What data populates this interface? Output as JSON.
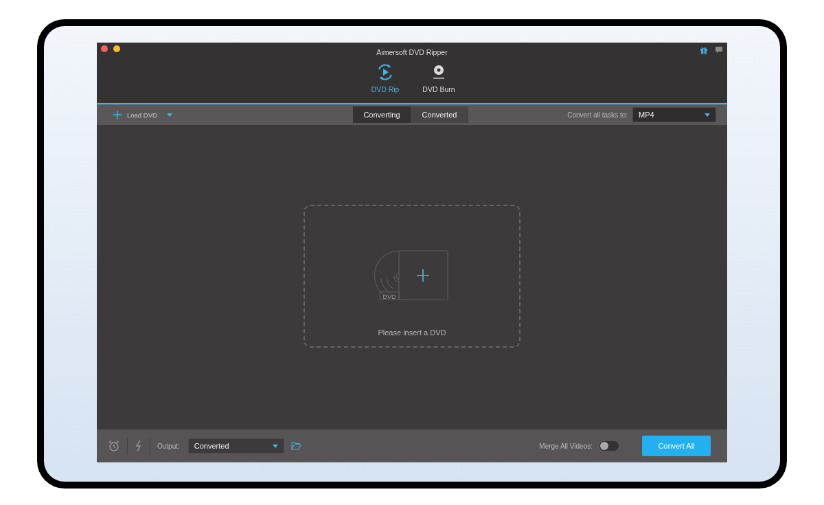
{
  "window": {
    "title": "Aimersoft DVD Ripper"
  },
  "modes": [
    {
      "label": "DVD Rip",
      "kind": "rip",
      "selected": true
    },
    {
      "label": "DVD Burn",
      "kind": "burn",
      "selected": false
    }
  ],
  "toolbar": {
    "load_label": "Load DVD",
    "tabs": [
      {
        "label": "Converting",
        "selected": true
      },
      {
        "label": "Converted",
        "selected": false
      }
    ],
    "format_label": "Convert all tasks to:",
    "format_value": "MP4"
  },
  "drop_area": {
    "disc_label": "DVD",
    "message": "Please insert a DVD"
  },
  "bottom_bar": {
    "output_label": "Output:",
    "output_value": "Converted",
    "merge_label": "Merge All Videos:",
    "merge_on": false,
    "convert_button": "Convert All"
  }
}
